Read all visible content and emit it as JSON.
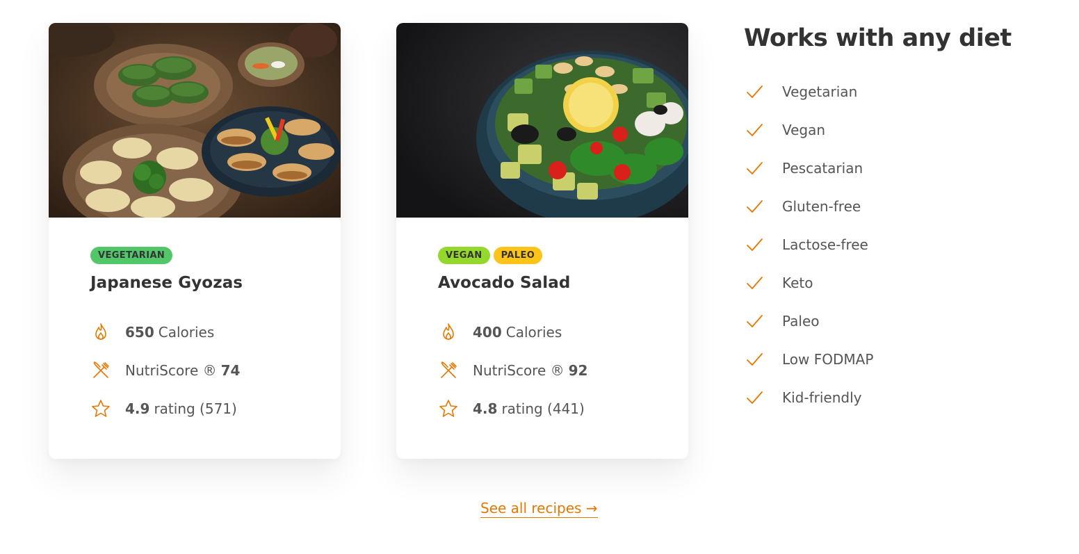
{
  "accent_color": "#e67700",
  "cards": [
    {
      "image_alt": "Japanese Gyozas",
      "tags": [
        "Vegetarian"
      ],
      "title": "Japanese Gyozas",
      "calories_value": "650",
      "calories_label": "Calories",
      "nutriscore_label": "NutriScore ®",
      "nutriscore_value": "74",
      "rating_value": "4.9",
      "rating_label": "rating (571)"
    },
    {
      "image_alt": "Avocado Salad",
      "tags": [
        "Vegan",
        "Paleo"
      ],
      "title": "Avocado Salad",
      "calories_value": "400",
      "calories_label": "Calories",
      "nutriscore_label": "NutriScore ®",
      "nutriscore_value": "92",
      "rating_value": "4.8",
      "rating_label": "rating (441)"
    }
  ],
  "diets": {
    "title": "Works with any diet",
    "items": [
      "Vegetarian",
      "Vegan",
      "Pescatarian",
      "Gluten-free",
      "Lactose-free",
      "Keto",
      "Paleo",
      "Low FODMAP",
      "Kid-friendly"
    ]
  },
  "see_all_link": "See all recipes →"
}
